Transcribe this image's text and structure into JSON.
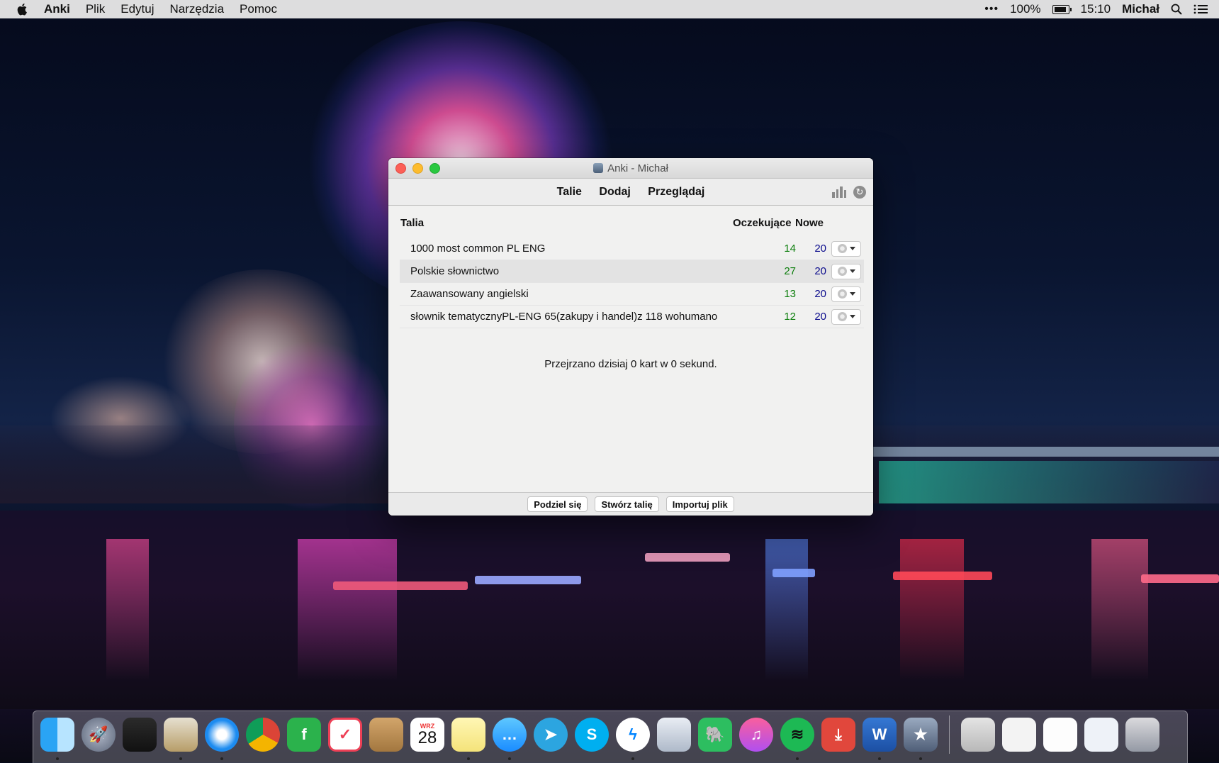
{
  "menubar": {
    "app": "Anki",
    "items": [
      "Plik",
      "Edytuj",
      "Narzędzia",
      "Pomoc"
    ],
    "battery": "100%",
    "battery_level": 1.0,
    "time": "15:10",
    "user": "Michał"
  },
  "window": {
    "title": "Anki - Michał",
    "toolbar": {
      "decks": "Talie",
      "add": "Dodaj",
      "browse": "Przeglądaj"
    },
    "columns": {
      "deck": "Talia",
      "due": "Oczekujące",
      "new": "Nowe"
    },
    "decks": [
      {
        "name": "1000 most common PL ENG",
        "due": "14",
        "new": "20"
      },
      {
        "name": "Polskie słownictwo",
        "due": "27",
        "new": "20"
      },
      {
        "name": "Zaawansowany angielski",
        "due": "13",
        "new": "20"
      },
      {
        "name": "słownik tematycznyPL-ENG 65(zakupy i handel)z 118 wohumano",
        "due": "12",
        "new": "20"
      }
    ],
    "summary": "Przejrzano dzisiaj 0 kart w 0 sekund.",
    "buttons": {
      "share": "Podziel się",
      "create": "Stwórz talię",
      "import": "Importuj plik"
    }
  },
  "dock": {
    "calendar_month": "WRZ",
    "calendar_day": "28",
    "items": [
      "finder-icon",
      "launchpad-icon",
      "photo-booth-icon",
      "mail-icon",
      "safari-icon",
      "chrome-icon",
      "feedly-icon",
      "pocket-icon",
      "contacts-icon",
      "calendar-icon",
      "notes-icon",
      "messages-icon",
      "telegram-icon",
      "skype-icon",
      "messenger-icon",
      "preview-icon",
      "evernote-icon",
      "itunes-icon",
      "spotify-icon",
      "pdf-icon",
      "word-icon",
      "anki-icon",
      "documents-folder-icon",
      "screenshot-icon",
      "file-icon",
      "document-icon",
      "trash-icon"
    ]
  },
  "colors": {
    "due": "#0b7d0b",
    "new": "#0a0a8c"
  }
}
